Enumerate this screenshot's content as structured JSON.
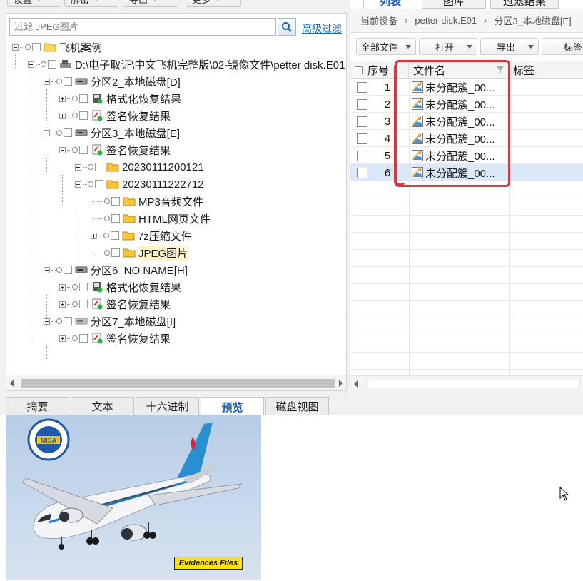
{
  "top_toolbar": {
    "buttons": [
      "设置",
      "解密",
      "导出",
      "更多"
    ]
  },
  "left": {
    "filter_placeholder": "过滤 JPEG图片",
    "advanced_filter": "高级过滤",
    "tree": [
      "飞机案例",
      "D:\\电子取证\\中文飞机完整版\\02-镜像文件\\petter disk.E01",
      "分区2_本地磁盘[D]",
      "格式化恢复结果",
      "签名恢复结果",
      "分区3_本地磁盘[E]",
      "签名恢复结果",
      "20230111200121",
      "20230111222712",
      "MP3音频文件",
      "HTML网页文件",
      "7z压缩文件",
      "JPEG图片",
      "分区6_NO NAME[H]",
      "格式化恢复结果",
      "签名恢复结果",
      "分区7_本地磁盘[I]",
      "签名恢复结果"
    ]
  },
  "right": {
    "tabs": [
      "列表",
      "图库",
      "过滤结果"
    ],
    "breadcrumb": [
      "当前设备",
      "petter disk.E01",
      "分区3_本地磁盘[E]"
    ],
    "toolbar": {
      "all_files": "全部文件",
      "open": "打开",
      "export": "导出",
      "tag": "标签"
    },
    "columns": {
      "index": "序号",
      "filename": "文件名",
      "tag": "标签"
    },
    "rows": [
      {
        "index": "1",
        "name": "未分配簇_00..."
      },
      {
        "index": "2",
        "name": "未分配簇_00..."
      },
      {
        "index": "3",
        "name": "未分配簇_00..."
      },
      {
        "index": "4",
        "name": "未分配簇_00..."
      },
      {
        "index": "5",
        "name": "未分配簇_00..."
      },
      {
        "index": "6",
        "name": "未分配簇_00..."
      }
    ],
    "selected_row": "6"
  },
  "bottom_tabs": [
    "摘要",
    "文本",
    "十六进制",
    "预览",
    "磁盘视图"
  ],
  "active_bottom_tab": "预览",
  "preview": {
    "badge_text": "Evidences Files",
    "logo_text": "MISA"
  },
  "colors": {
    "accent": "#1a5fb4",
    "selection": "#dbe8f8",
    "annotation": "#d9363e",
    "badge": "#ffe10f"
  }
}
